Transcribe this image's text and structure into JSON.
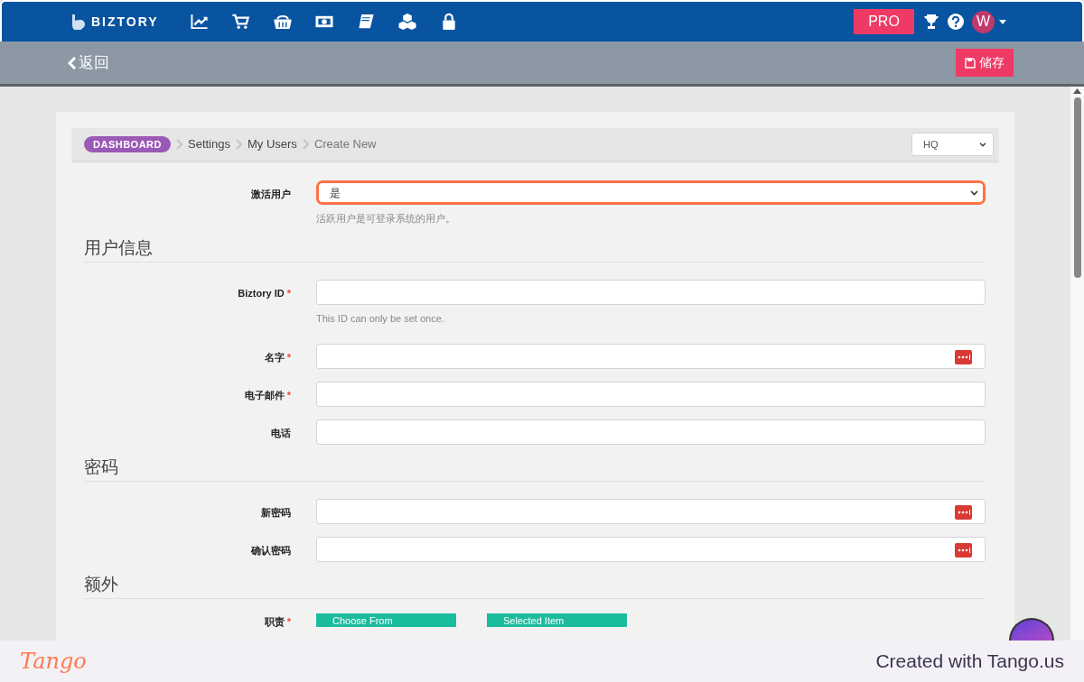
{
  "topbar": {
    "brand": "BIZTORY",
    "pro": "PRO",
    "avatar": "W"
  },
  "subbar": {
    "back": "返回",
    "save": "储存"
  },
  "breadcrumb": {
    "root": "DASHBOARD",
    "items": [
      "Settings",
      "My Users",
      "Create New"
    ],
    "branch": "HQ"
  },
  "form": [
    {
      "kind": "select",
      "label": "激活用户",
      "value": "是",
      "focused": true,
      "hint": "活跃用户是可登录系统的用户。",
      "autofill": false
    },
    {
      "kind": "section",
      "title": "用户信息"
    },
    {
      "kind": "text",
      "label": "Biztory ID",
      "required_mark": "*",
      "focused": false,
      "hint": "This ID can only be set once.",
      "autofill": false
    },
    {
      "kind": "text",
      "label": "名字",
      "required_mark": "*",
      "focused": false,
      "autofill": true
    },
    {
      "kind": "text",
      "label": "电子邮件",
      "required_mark": "*",
      "focused": false,
      "autofill": false
    },
    {
      "kind": "text",
      "label": "电话",
      "focused": false,
      "autofill": false
    },
    {
      "kind": "section",
      "title": "密码"
    },
    {
      "kind": "text",
      "label": "新密码",
      "focused": false,
      "autofill": true
    },
    {
      "kind": "text",
      "label": "确认密码",
      "focused": false,
      "autofill": true
    },
    {
      "kind": "section",
      "title": "额外"
    },
    {
      "kind": "dual_list",
      "label": "职责",
      "required_mark": "*",
      "panels": [
        "Choose From",
        "Selected Item"
      ]
    }
  ],
  "footer": {
    "logo": "Tango",
    "credit": "Created with Tango.us"
  }
}
